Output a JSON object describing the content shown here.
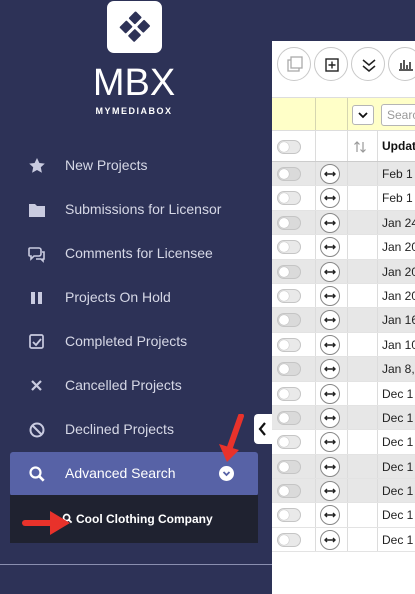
{
  "brand": {
    "name": "MBX",
    "tagline": "MYMEDIABOX"
  },
  "sidebar": {
    "items": [
      {
        "label": "New Projects",
        "icon": "star-icon"
      },
      {
        "label": "Submissions for Licensor",
        "icon": "folder-icon"
      },
      {
        "label": "Comments for Licensee",
        "icon": "comments-icon"
      },
      {
        "label": "Projects On Hold",
        "icon": "pause-icon"
      },
      {
        "label": "Completed Projects",
        "icon": "check-square-icon"
      },
      {
        "label": "Cancelled Projects",
        "icon": "x-icon"
      },
      {
        "label": "Declined Projects",
        "icon": "ban-icon"
      },
      {
        "label": "Advanced Search",
        "icon": "search-icon",
        "active": true
      }
    ],
    "saved_search": "Cool Clothing Company"
  },
  "table": {
    "search_placeholder": "Search",
    "column_header": "Updated",
    "rows": [
      {
        "date": "Feb 1",
        "shade": "grey"
      },
      {
        "date": "Feb 1",
        "shade": "white"
      },
      {
        "date": "Jan 24",
        "shade": "grey"
      },
      {
        "date": "Jan 20",
        "shade": "white"
      },
      {
        "date": "Jan 20",
        "shade": "grey"
      },
      {
        "date": "Jan 20",
        "shade": "white"
      },
      {
        "date": "Jan 16",
        "shade": "grey"
      },
      {
        "date": "Jan 10",
        "shade": "white"
      },
      {
        "date": "Jan 8,",
        "shade": "grey"
      },
      {
        "date": "Dec 1",
        "shade": "white"
      },
      {
        "date": "Dec 1",
        "shade": "grey"
      },
      {
        "date": "Dec 1",
        "shade": "white"
      },
      {
        "date": "Dec 1",
        "shade": "grey"
      },
      {
        "date": "Dec 1",
        "shade": "grey"
      },
      {
        "date": "Dec 1",
        "shade": "white"
      },
      {
        "date": "Dec 1",
        "shade": "white"
      }
    ]
  },
  "colors": {
    "sidebar_bg": "#2d3257",
    "active_item": "#5762a6",
    "filter_row": "#ffffc8",
    "arrow_red": "#e8322b"
  }
}
